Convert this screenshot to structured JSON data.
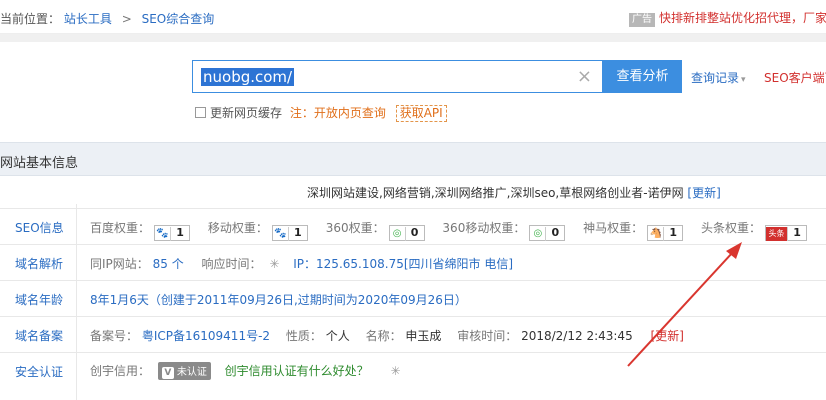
{
  "breadcrumb": {
    "prefix": "当前位置：",
    "items": [
      "站长工具",
      "SEO综合查询"
    ],
    "sep": ">"
  },
  "ad": {
    "tag": "广告",
    "text": "快排新排整站优化招代理，厂家！"
  },
  "search": {
    "value": "nuobg.com/",
    "clear_icon": "×",
    "button": "查看分析",
    "history": "查询记录",
    "history_caret": "▾",
    "seo_client": "SEO客户端下"
  },
  "options": {
    "refresh_label": "更新网页缓存",
    "note": "注：开放内页查询",
    "api": "获取API"
  },
  "section": {
    "title": "网站基本信息"
  },
  "site_title": {
    "text": "深圳网站建设,网络营销,深圳网络推广,深圳seo,草根网络创业者-诺伊网",
    "update": "[更新]"
  },
  "seo_row": {
    "label": "SEO信息",
    "weights": [
      {
        "name": "百度权重：",
        "icon": "paw-icon",
        "glyph": "🐾",
        "value": "1"
      },
      {
        "name": "移动权重：",
        "icon": "paw-icon",
        "glyph": "🐾",
        "value": "1"
      },
      {
        "name": "360权重：",
        "icon": "360-icon",
        "glyph": "◎",
        "value": "0"
      },
      {
        "name": "360移动权重：",
        "icon": "360-icon",
        "glyph": "◎",
        "value": "0"
      },
      {
        "name": "神马权重：",
        "icon": "shenma-icon",
        "glyph": "🐴",
        "value": "1"
      },
      {
        "name": "头条权重：",
        "icon": "toutiao-icon",
        "glyph": "头条",
        "value": "1"
      }
    ]
  },
  "dns_row": {
    "label": "域名解析",
    "same_ip_label": "同IP网站：",
    "same_ip_value": "85 个",
    "resp_label": "响应时间：",
    "spinner": "✳",
    "ip_text": "IP：125.65.108.75[四川省绵阳市 电信]"
  },
  "age_row": {
    "label": "域名年龄",
    "text": "8年1月6天（创建于2011年09月26日,过期时间为2020年09月26日）"
  },
  "icp_row": {
    "label": "域名备案",
    "no_label": "备案号：",
    "no_value": "粤ICP备16109411号-2",
    "nature_label": "性质：",
    "nature_value": "个人",
    "name_label": "名称：",
    "name_value": "申玉成",
    "time_label": "审核时间：",
    "time_value": "2018/2/12 2:43:45",
    "update": "[更新]"
  },
  "cert_row": {
    "label": "安全认证",
    "credit_label": "创宇信用：",
    "badge_v": "V",
    "badge_text": "未认证",
    "question": "创宇信用认证有什么好处？",
    "spinner": "✳"
  },
  "colors": {
    "accent": "#3c8ee0",
    "link": "#2a6cc2",
    "red": "#d2302e",
    "orange": "#e06f1a",
    "arrow": "#d9362f"
  }
}
